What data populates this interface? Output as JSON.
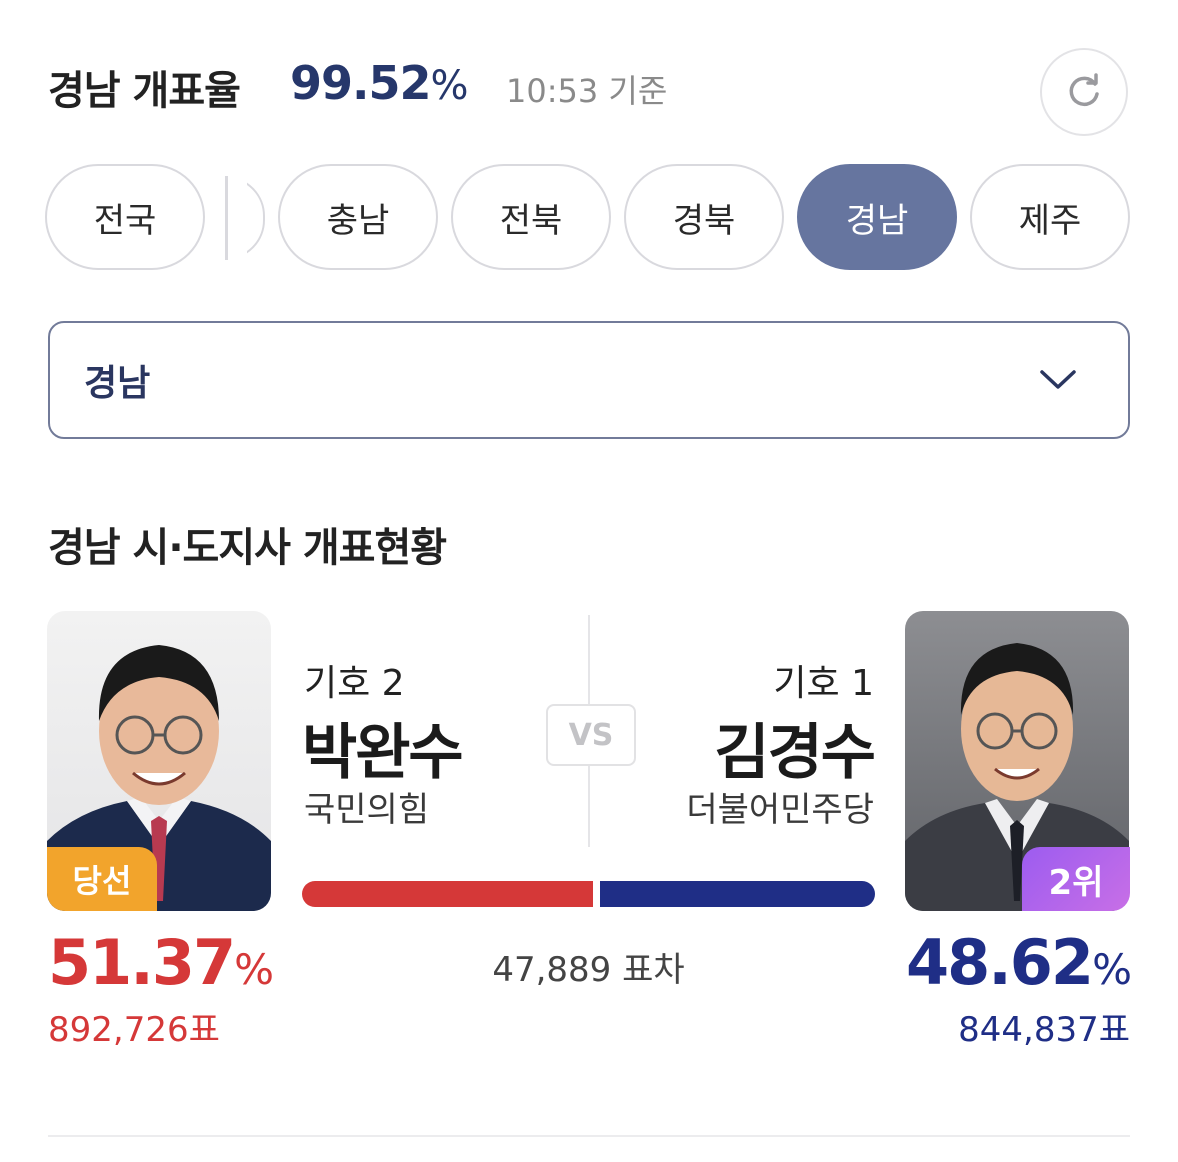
{
  "header": {
    "title": "경남 개표율",
    "rate": "99.52",
    "rate_unit": "%",
    "time": "10:53 기준"
  },
  "chips": [
    {
      "label": "전국",
      "active": false
    },
    {
      "label": "충남",
      "active": false
    },
    {
      "label": "전북",
      "active": false
    },
    {
      "label": "경북",
      "active": false
    },
    {
      "label": "경남",
      "active": true
    },
    {
      "label": "제주",
      "active": false
    }
  ],
  "region_select": {
    "value": "경남"
  },
  "section_title": "경남 시·도지사 개표현황",
  "vs_label": "VS",
  "candidates": {
    "left": {
      "number": "기호 2",
      "name": "박완수",
      "party": "국민의힘",
      "badge": "당선",
      "percent": "51.37",
      "percent_unit": "%",
      "votes": "892,726표",
      "color": "#d53838",
      "share": 51.37
    },
    "right": {
      "number": "기호 1",
      "name": "김경수",
      "party": "더불어민주당",
      "badge": "2위",
      "percent": "48.62",
      "percent_unit": "%",
      "votes": "844,837표",
      "color": "#1f2e86",
      "share": 48.62
    }
  },
  "margin": "47,889 표차",
  "icons": {
    "refresh": "refresh-icon",
    "dropdown": "chevron-down-icon"
  }
}
